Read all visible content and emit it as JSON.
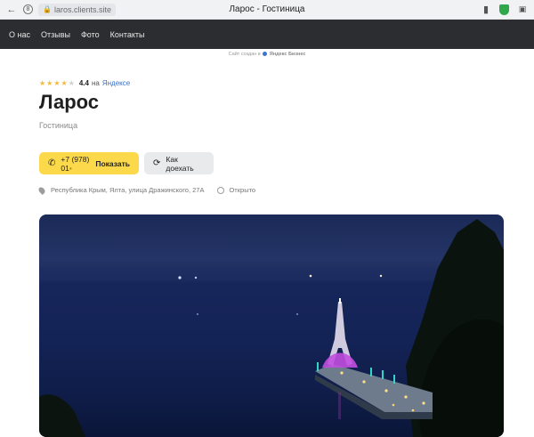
{
  "browser": {
    "url": "laros.clients.site",
    "tab_title": "Ларос - Гостиница"
  },
  "nav": {
    "items": [
      "О нас",
      "Отзывы",
      "Фото",
      "Контакты"
    ]
  },
  "created_by": {
    "text": "Сайт создан в",
    "brand": "Яндекс Бизнес"
  },
  "rating": {
    "stars_filled": 4,
    "stars_total": 5,
    "score": "4.4",
    "on_label": "на",
    "source": "Яндексе"
  },
  "business": {
    "name": "Ларос",
    "category": "Гостиница"
  },
  "actions": {
    "phone_visible": "+7 (978) 01",
    "phone_faded": "•",
    "phone_show_label": "Показать",
    "route_label": "Как доехать"
  },
  "info": {
    "address": "Республика Крым, Ялта, улица Дражинского, 27А",
    "status": "Открыто"
  },
  "icons": {
    "phone": "phone-icon",
    "route": "route-icon",
    "location": "location-pin-icon",
    "hours": "clock-icon"
  },
  "colors": {
    "nav_bg": "#2b2d30",
    "phone_button": "#fcd94a",
    "route_button": "#e9eaec",
    "star": "#f5b83a",
    "link": "#3b6fc4"
  }
}
